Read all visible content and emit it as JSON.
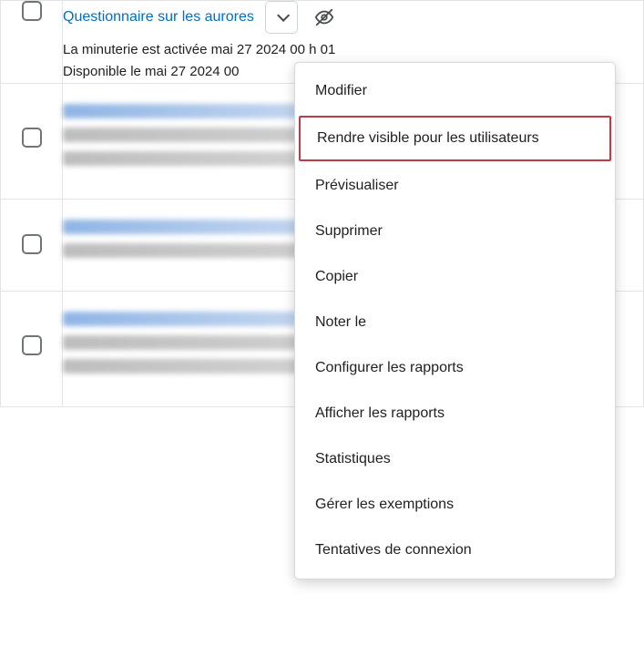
{
  "row1": {
    "title": "Questionnaire sur les aurores",
    "line1": "La minuterie est activée mai 27 2024 00 h 01",
    "line2": "Disponible le mai 27 2024 00"
  },
  "menu": {
    "m0": "Modifier",
    "m1": "Rendre visible pour les utilisateurs",
    "m2": "Prévisualiser",
    "m3": "Supprimer",
    "m4": "Copier",
    "m5": "Noter le",
    "m6": "Configurer les rapports",
    "m7": "Afficher les rapports",
    "m8": "Statistiques",
    "m9": "Gérer les exemptions",
    "m10": "Tentatives de connexion"
  }
}
